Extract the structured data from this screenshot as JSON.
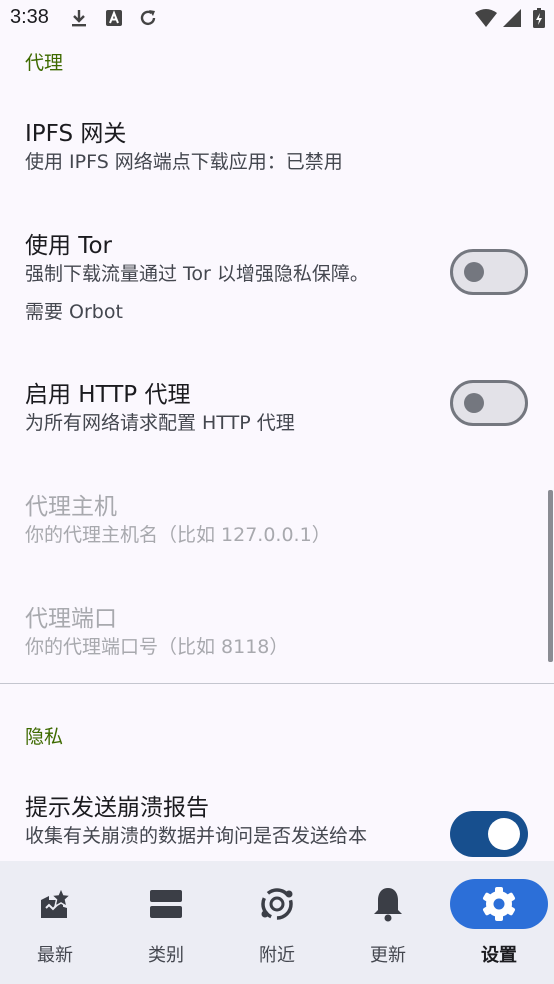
{
  "status_bar": {
    "time": "3:38",
    "left_icons": [
      "download-icon",
      "app-store-icon",
      "sync-icon"
    ],
    "right_icons": [
      "wifi-icon",
      "signal-icon",
      "battery-charging-icon"
    ]
  },
  "sections": {
    "proxy": {
      "title": "代理",
      "ipfs": {
        "title": "IPFS 网关",
        "summary": "使用 IPFS 网络端点下载应用：已禁用"
      },
      "tor": {
        "title": "使用 Tor",
        "summary_line1": "强制下载流量通过 Tor 以增强隐私保障。",
        "summary_line2": "需要 Orbot",
        "enabled": false
      },
      "http_proxy": {
        "title": "启用 HTTP 代理",
        "summary": "为所有网络请求配置 HTTP 代理",
        "enabled": false
      },
      "proxy_host": {
        "title": "代理主机",
        "summary": "你的代理主机名（比如 127.0.0.1）"
      },
      "proxy_port": {
        "title": "代理端口",
        "summary": "你的代理端口号（比如 8118）"
      }
    },
    "privacy": {
      "title": "隐私",
      "crash_reports": {
        "title": "提示发送崩溃报告",
        "summary": "收集有关崩溃的数据并询问是否发送给本",
        "enabled": true
      }
    }
  },
  "bottom_nav": {
    "items": [
      {
        "label": "最新",
        "icon": "sparkle-star-icon",
        "active": false
      },
      {
        "label": "类别",
        "icon": "categories-icon",
        "active": false
      },
      {
        "label": "附近",
        "icon": "nearby-icon",
        "active": false
      },
      {
        "label": "更新",
        "icon": "bell-icon",
        "active": false
      },
      {
        "label": "设置",
        "icon": "gear-icon",
        "active": true
      }
    ]
  },
  "colors": {
    "accent": "#2c6fd8",
    "toggle_on": "#174f8e",
    "section_title": "#3e6a00",
    "background": "#fbf8fe",
    "nav_background": "#ecedf4"
  }
}
